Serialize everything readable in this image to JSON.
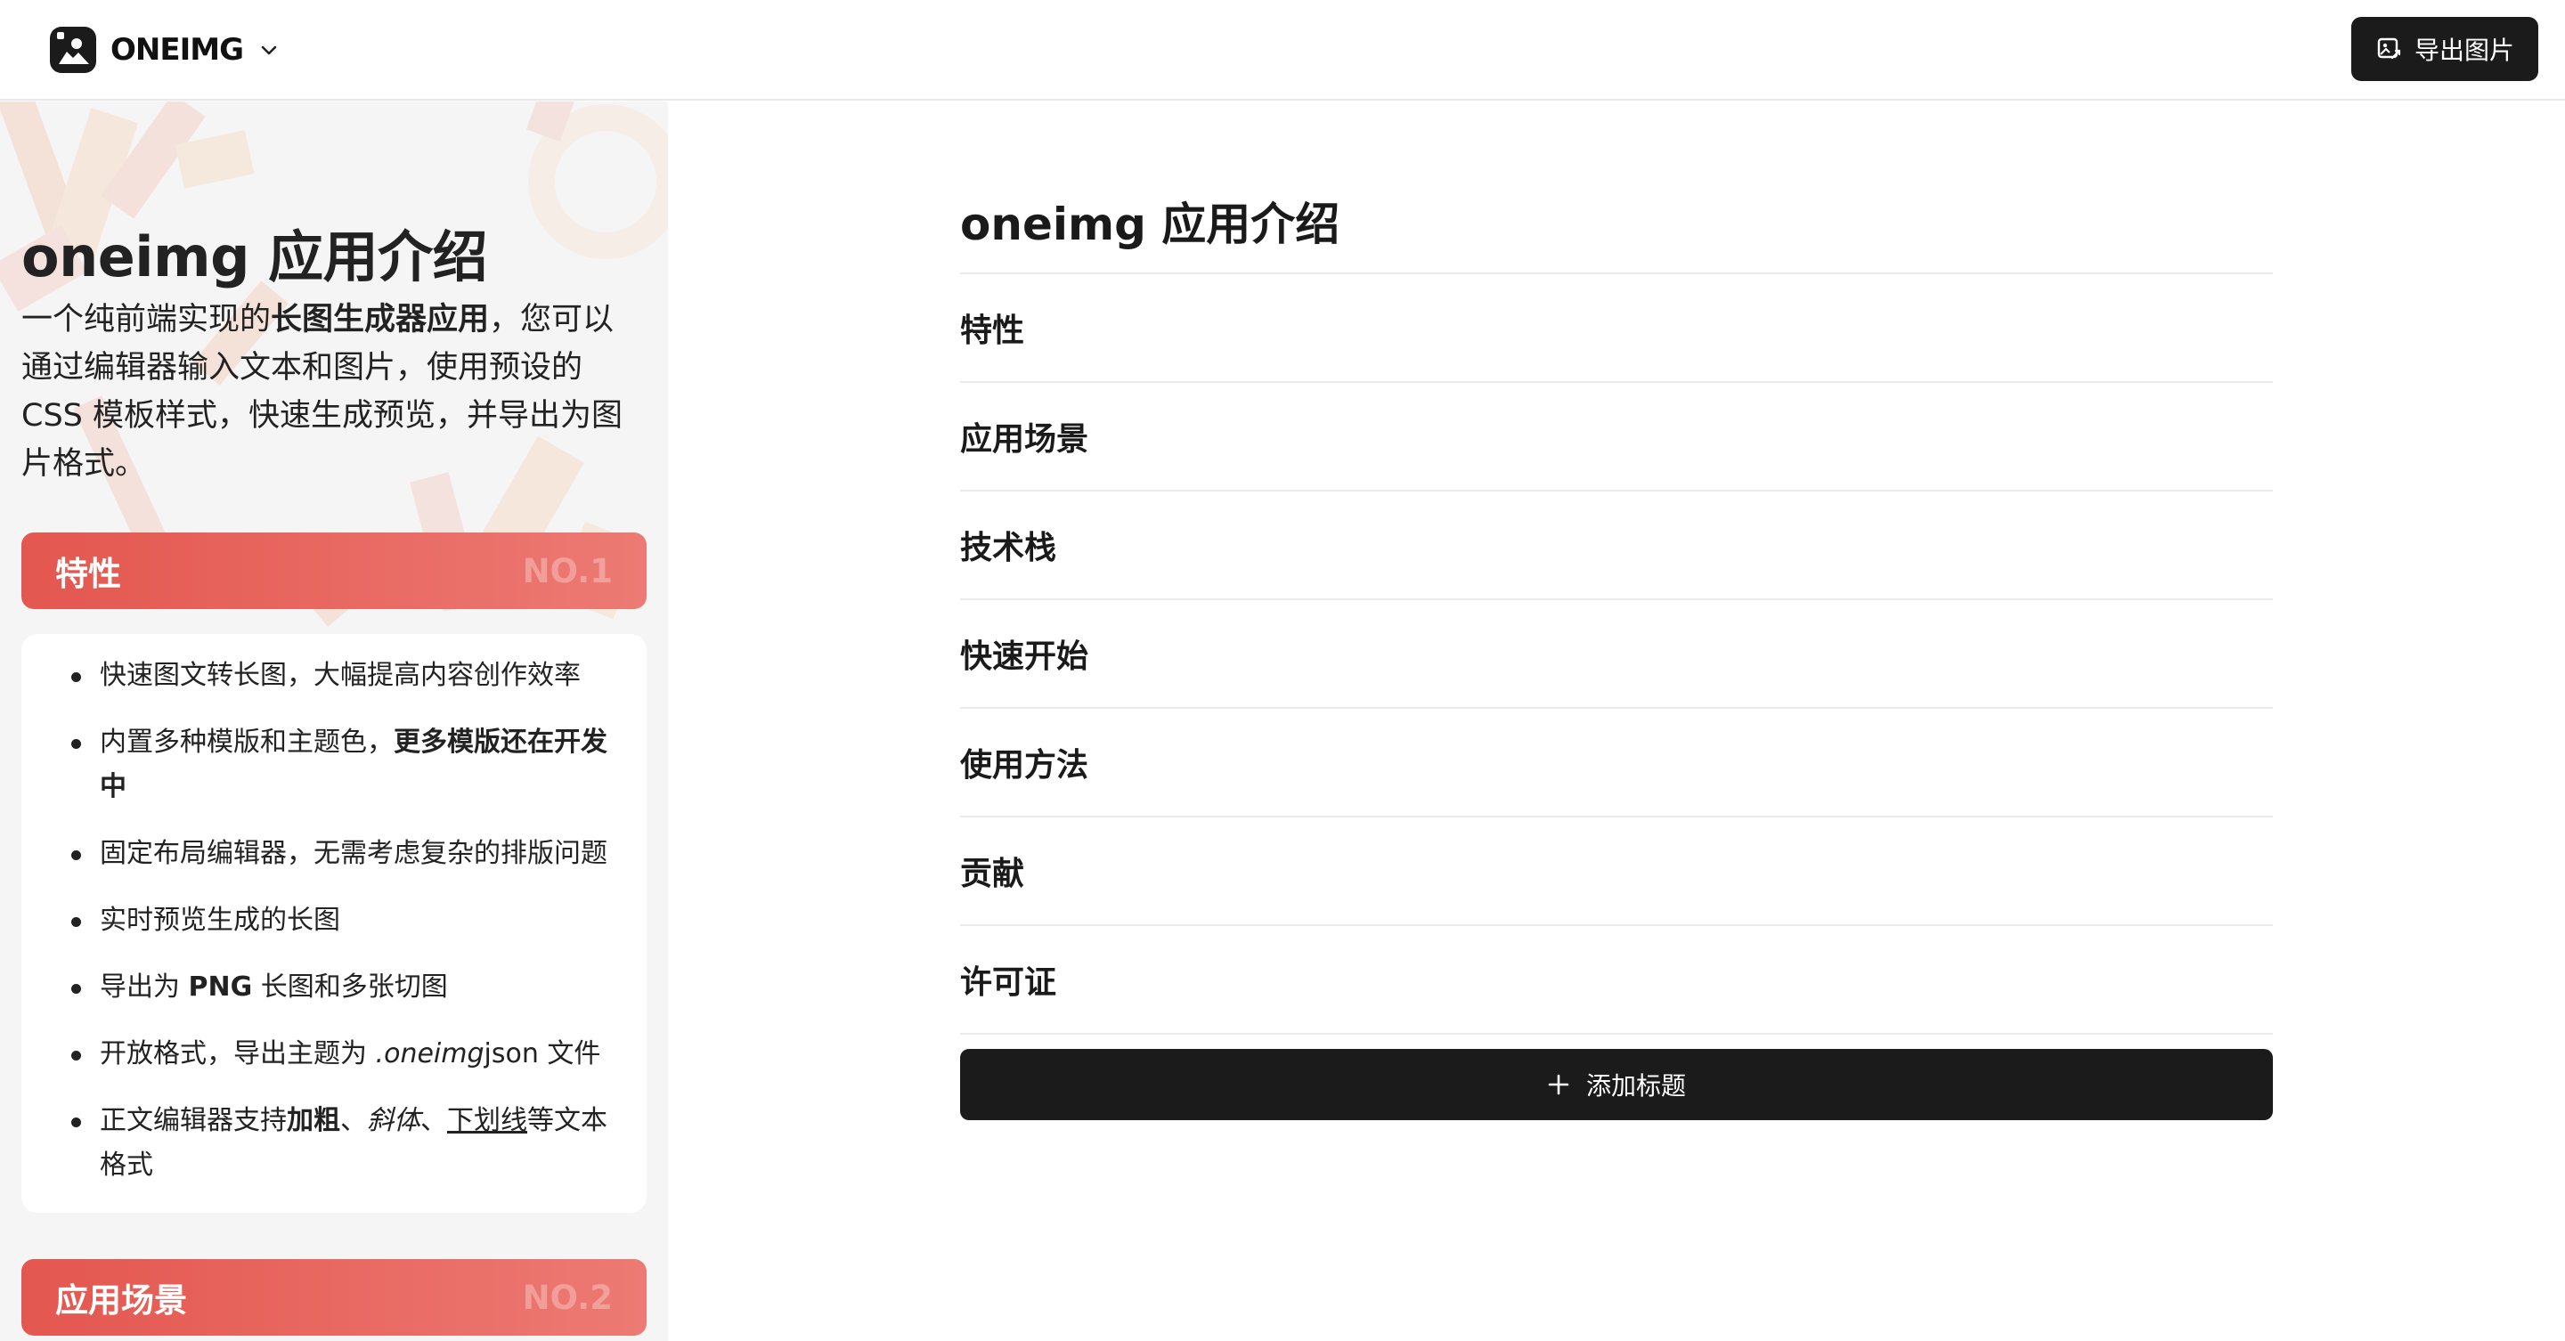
{
  "header": {
    "brand_name": "ONEIMG",
    "export_label": "导出图片",
    "icons": {
      "logo": "image-logo-icon",
      "chevron": "chevron-down-icon",
      "export": "image-export-icon"
    }
  },
  "preview": {
    "title": "oneimg 应用介绍",
    "desc": {
      "part1": "一个纯前端实现的",
      "bold": "长图生成器应用",
      "part2": "，您可以通过编辑器输入文本和图片，使用预设的 CSS 模板样式，快速生成预览，并导出为图片格式。"
    },
    "sections": [
      {
        "title": "特性",
        "no": "NO.1"
      },
      {
        "title": "应用场景",
        "no": "NO.2"
      }
    ],
    "features": {
      "f1": "快速图文转长图，大幅提高内容创作效率",
      "f2_text": "内置多种模版和主题色，",
      "f2_bold": "更多模版还在开发中",
      "f3": "固定布局编辑器，无需考虑复杂的排版问题",
      "f4": "实时预览生成的长图",
      "f5_pre": "导出为 ",
      "f5_bold": "PNG",
      "f5_post": " 长图和多张切图",
      "f6_pre": "开放格式，导出主题为 ",
      "f6_italic": ".oneimg",
      "f6_post": "json 文件",
      "f7_pre": "正文编辑器支持",
      "f7_bold": "加粗",
      "f7_sep1": "、",
      "f7_italic": "斜体",
      "f7_sep2": "、",
      "f7_underline": "下划线",
      "f7_post": "等文本格式"
    }
  },
  "editor": {
    "title": "oneimg 应用介绍",
    "items": [
      "特性",
      "应用场景",
      "技术栈",
      "快速开始",
      "使用方法",
      "贡献",
      "许可证"
    ],
    "add_label": "添加标题",
    "add_icon": "plus-icon"
  },
  "colors": {
    "accent_start": "#e3574f",
    "accent_end": "#ed7a74",
    "dark": "#1b1b1b"
  }
}
